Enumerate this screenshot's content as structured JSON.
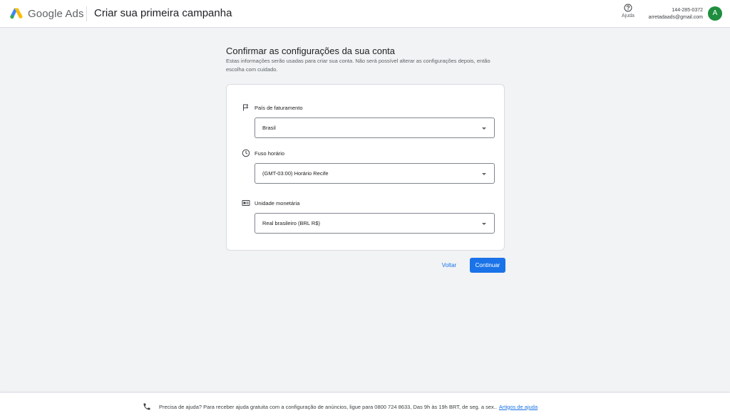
{
  "header": {
    "brand": "Google Ads",
    "title": "Criar sua primeira campanha",
    "help_label": "Ajuda",
    "account_id": "144-285-0372",
    "account_email": "arretadaads@gmail.com",
    "avatar_initial": "A"
  },
  "main": {
    "title": "Confirmar as configurações da sua conta",
    "description": "Estas informações serão usadas para criar sua conta. Não será possível alterar as configurações depois, então escolha com cuidado."
  },
  "fields": [
    {
      "label": "País de faturamento",
      "value": "Brasil",
      "icon": "flag-icon"
    },
    {
      "label": "Fuso horário",
      "value": "(GMT-03:00) Horário Recife",
      "icon": "clock-icon"
    },
    {
      "label": "Unidade monetária",
      "value": "Real brasileiro (BRL R$)",
      "icon": "currency-icon"
    }
  ],
  "actions": {
    "back_label": "Voltar",
    "continue_label": "Continuar"
  },
  "footer": {
    "text": "Precisa de ajuda? Para receber ajuda gratuita com a configuração de anúncios, ligue para 0800 724 8633, Das 9h às 19h BRT, de seg. a sex..",
    "link_label": "Artigos de ajuda"
  },
  "colors": {
    "accent": "#1a73e8",
    "avatar": "#1e8e3e",
    "background": "#f1f3f4"
  }
}
